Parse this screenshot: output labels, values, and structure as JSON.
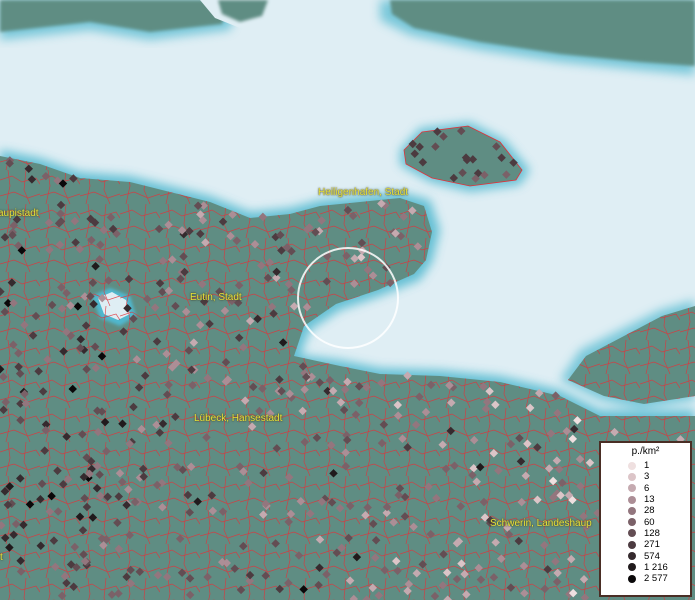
{
  "places": [
    {
      "name": "Heiligenhafen, Stadt"
    },
    {
      "name": "aupistadt"
    },
    {
      "name": "Eutin, Stadt"
    },
    {
      "name": "Lübeck, Hansestadt"
    },
    {
      "name": "Schwerin, Landeshaup"
    },
    {
      "name": "t"
    }
  ],
  "legend": {
    "title": "p./km²",
    "items": [
      {
        "label": "1",
        "color": "#efe0e0"
      },
      {
        "label": "3",
        "color": "#dcc5c8"
      },
      {
        "label": "6",
        "color": "#c5aab0"
      },
      {
        "label": "13",
        "color": "#ac8e96"
      },
      {
        "label": "28",
        "color": "#93767e"
      },
      {
        "label": "60",
        "color": "#7b6168"
      },
      {
        "label": "128",
        "color": "#634d53"
      },
      {
        "label": "271",
        "color": "#4c3b40"
      },
      {
        "label": "574",
        "color": "#352a2e"
      },
      {
        "label": "1 216",
        "color": "#201a1c"
      },
      {
        "label": "2 577",
        "color": "#0a0809"
      }
    ]
  },
  "colors": {
    "sea": "#dfeef4",
    "land": "#5f8d83",
    "boundary": "#e0323a",
    "shore_glow": "#4fb8cf",
    "place_label": "#e8e23a"
  }
}
